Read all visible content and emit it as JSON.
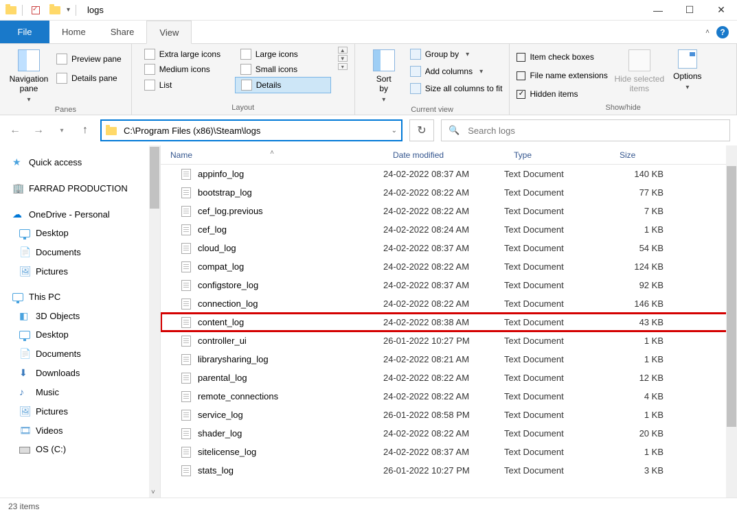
{
  "titlebar": {
    "title": "logs"
  },
  "tabs": {
    "file": "File",
    "home": "Home",
    "share": "Share",
    "view": "View"
  },
  "ribbon": {
    "panes": {
      "label": "Panes",
      "navigation": "Navigation\npane",
      "preview": "Preview pane",
      "details": "Details pane"
    },
    "layout": {
      "label": "Layout",
      "extra_large": "Extra large icons",
      "large": "Large icons",
      "medium": "Medium icons",
      "small": "Small icons",
      "list": "List",
      "details": "Details"
    },
    "current_view": {
      "label": "Current view",
      "sort": "Sort\nby",
      "group_by": "Group by",
      "add_columns": "Add columns",
      "size_all": "Size all columns to fit"
    },
    "show_hide": {
      "label": "Show/hide",
      "item_cb": "Item check boxes",
      "file_ext": "File name extensions",
      "hidden": "Hidden items",
      "hide_selected": "Hide selected\nitems",
      "options": "Options"
    }
  },
  "address": {
    "path": "C:\\Program Files (x86)\\Steam\\logs",
    "search_placeholder": "Search logs"
  },
  "tree": {
    "quick_access": "Quick access",
    "farrad": "FARRAD PRODUCTION",
    "onedrive": "OneDrive - Personal",
    "od_desktop": "Desktop",
    "od_documents": "Documents",
    "od_pictures": "Pictures",
    "this_pc": "This PC",
    "pc_3d": "3D Objects",
    "pc_desktop": "Desktop",
    "pc_documents": "Documents",
    "pc_downloads": "Downloads",
    "pc_music": "Music",
    "pc_pictures": "Pictures",
    "pc_videos": "Videos",
    "pc_osc": "OS (C:)"
  },
  "columns": {
    "name": "Name",
    "date": "Date modified",
    "type": "Type",
    "size": "Size"
  },
  "files": [
    {
      "name": "appinfo_log",
      "date": "24-02-2022 08:37 AM",
      "type": "Text Document",
      "size": "140 KB",
      "hl": false
    },
    {
      "name": "bootstrap_log",
      "date": "24-02-2022 08:22 AM",
      "type": "Text Document",
      "size": "77 KB",
      "hl": false
    },
    {
      "name": "cef_log.previous",
      "date": "24-02-2022 08:22 AM",
      "type": "Text Document",
      "size": "7 KB",
      "hl": false
    },
    {
      "name": "cef_log",
      "date": "24-02-2022 08:24 AM",
      "type": "Text Document",
      "size": "1 KB",
      "hl": false
    },
    {
      "name": "cloud_log",
      "date": "24-02-2022 08:37 AM",
      "type": "Text Document",
      "size": "54 KB",
      "hl": false
    },
    {
      "name": "compat_log",
      "date": "24-02-2022 08:22 AM",
      "type": "Text Document",
      "size": "124 KB",
      "hl": false
    },
    {
      "name": "configstore_log",
      "date": "24-02-2022 08:37 AM",
      "type": "Text Document",
      "size": "92 KB",
      "hl": false
    },
    {
      "name": "connection_log",
      "date": "24-02-2022 08:22 AM",
      "type": "Text Document",
      "size": "146 KB",
      "hl": false
    },
    {
      "name": "content_log",
      "date": "24-02-2022 08:38 AM",
      "type": "Text Document",
      "size": "43 KB",
      "hl": true
    },
    {
      "name": "controller_ui",
      "date": "26-01-2022 10:27 PM",
      "type": "Text Document",
      "size": "1 KB",
      "hl": false
    },
    {
      "name": "librarysharing_log",
      "date": "24-02-2022 08:21 AM",
      "type": "Text Document",
      "size": "1 KB",
      "hl": false
    },
    {
      "name": "parental_log",
      "date": "24-02-2022 08:22 AM",
      "type": "Text Document",
      "size": "12 KB",
      "hl": false
    },
    {
      "name": "remote_connections",
      "date": "24-02-2022 08:22 AM",
      "type": "Text Document",
      "size": "4 KB",
      "hl": false
    },
    {
      "name": "service_log",
      "date": "26-01-2022 08:58 PM",
      "type": "Text Document",
      "size": "1 KB",
      "hl": false
    },
    {
      "name": "shader_log",
      "date": "24-02-2022 08:22 AM",
      "type": "Text Document",
      "size": "20 KB",
      "hl": false
    },
    {
      "name": "sitelicense_log",
      "date": "24-02-2022 08:37 AM",
      "type": "Text Document",
      "size": "1 KB",
      "hl": false
    },
    {
      "name": "stats_log",
      "date": "26-01-2022 10:27 PM",
      "type": "Text Document",
      "size": "3 KB",
      "hl": false
    }
  ],
  "status": {
    "items": "23 items"
  }
}
